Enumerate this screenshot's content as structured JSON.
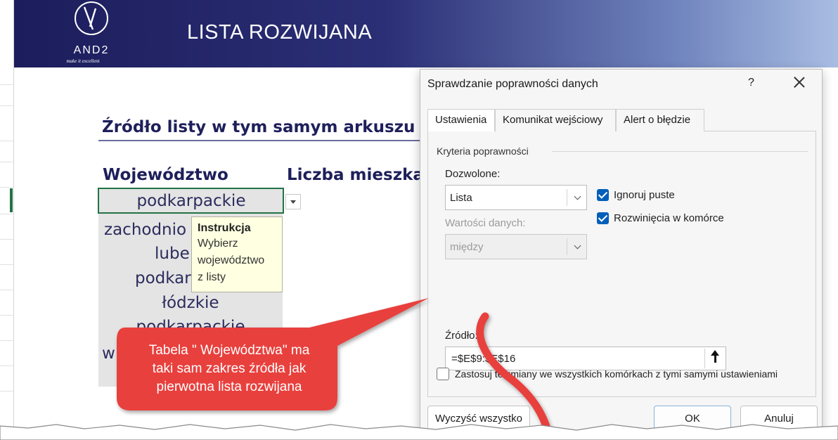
{
  "banner": {
    "title": "LISTA ROZWIJANA",
    "logo_text": "AND2",
    "logo_tagline": "make it excellent"
  },
  "sheet": {
    "section_title": "Źródło listy w tym samym arkuszu",
    "column_headers": [
      "Województwo",
      "Liczba mieszkań"
    ],
    "selected_cell": "podkarpackie",
    "rows": [
      "zachodnio",
      "lube",
      "podkar",
      "łódzkie",
      "podkarpackie",
      "w"
    ]
  },
  "tooltip": {
    "title": "Instrukcja",
    "lines": [
      "Wybierz",
      "województwo",
      "z listy"
    ]
  },
  "callout": {
    "lines": [
      "Tabela \" Województwa\" ma",
      "taki sam zakres źródła jak",
      "pierwotna lista rozwijana"
    ],
    "color": "#e8403d"
  },
  "dialog": {
    "title": "Sprawdzanie poprawności danych",
    "help": "?",
    "tabs": [
      "Ustawienia",
      "Komunikat wejściowy",
      "Alert o błędzie"
    ],
    "group_label": "Kryteria poprawności",
    "allow_label": "Dozwolone:",
    "allow_value": "Lista",
    "data_label": "Wartości danych:",
    "data_value": "między",
    "ignore_blank": "Ignoruj puste",
    "incell_dropdown": "Rozwinięcia w komórce",
    "source_label": "Źródło:",
    "source_value": "=$E$9:$E$16",
    "apply_all": "Zastosuj te zmiany we wszystkich komórkach z tymi samymi ustawieniami",
    "clear_button": "Wyczyść wszystko",
    "ok_button": "OK",
    "cancel_button": "Anuluj"
  },
  "colors": {
    "accent_green": "#217346",
    "banner_dark": "#1c1d5c",
    "checkbox_blue": "#005fb8"
  }
}
